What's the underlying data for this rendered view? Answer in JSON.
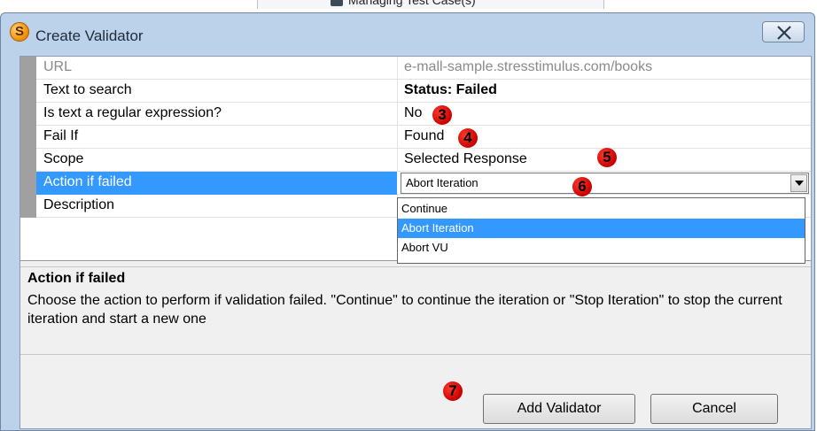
{
  "background": {
    "text": "Managing Test Case(s)"
  },
  "dialog": {
    "title": "Create Validator",
    "icon_letter": "S",
    "close_icon": "close-x-icon"
  },
  "grid": {
    "rows": [
      {
        "name": "URL",
        "value": "e-mall-sample.stresstimulus.com/books",
        "state": "disabled"
      },
      {
        "name": "Text to search",
        "value": "Status: Failed",
        "state": "bold"
      },
      {
        "name": "Is text a regular expression?",
        "value": "No"
      },
      {
        "name": "Fail If",
        "value": "Found"
      },
      {
        "name": "Scope",
        "value": "Selected Response"
      },
      {
        "name": "Action if failed",
        "value": "Abort Iteration",
        "state": "selected"
      },
      {
        "name": "Description",
        "value": ""
      }
    ]
  },
  "dropdown": {
    "options": [
      "Continue",
      "Abort Iteration",
      "Abort VU"
    ],
    "selected": "Abort Iteration"
  },
  "help": {
    "title": "Action if failed",
    "description": "Choose the action to perform if validation failed. \"Continue\" to continue the iteration or \"Stop Iteration\" to stop the current iteration and start a new one"
  },
  "buttons": {
    "add": "Add Validator",
    "cancel": "Cancel"
  },
  "markers": {
    "m3": "3",
    "m4": "4",
    "m5": "5",
    "m6": "6",
    "m7": "7"
  },
  "colors": {
    "selection": "#3399ff",
    "marker": "#e00000",
    "title_bar": "#bcd2ea"
  }
}
